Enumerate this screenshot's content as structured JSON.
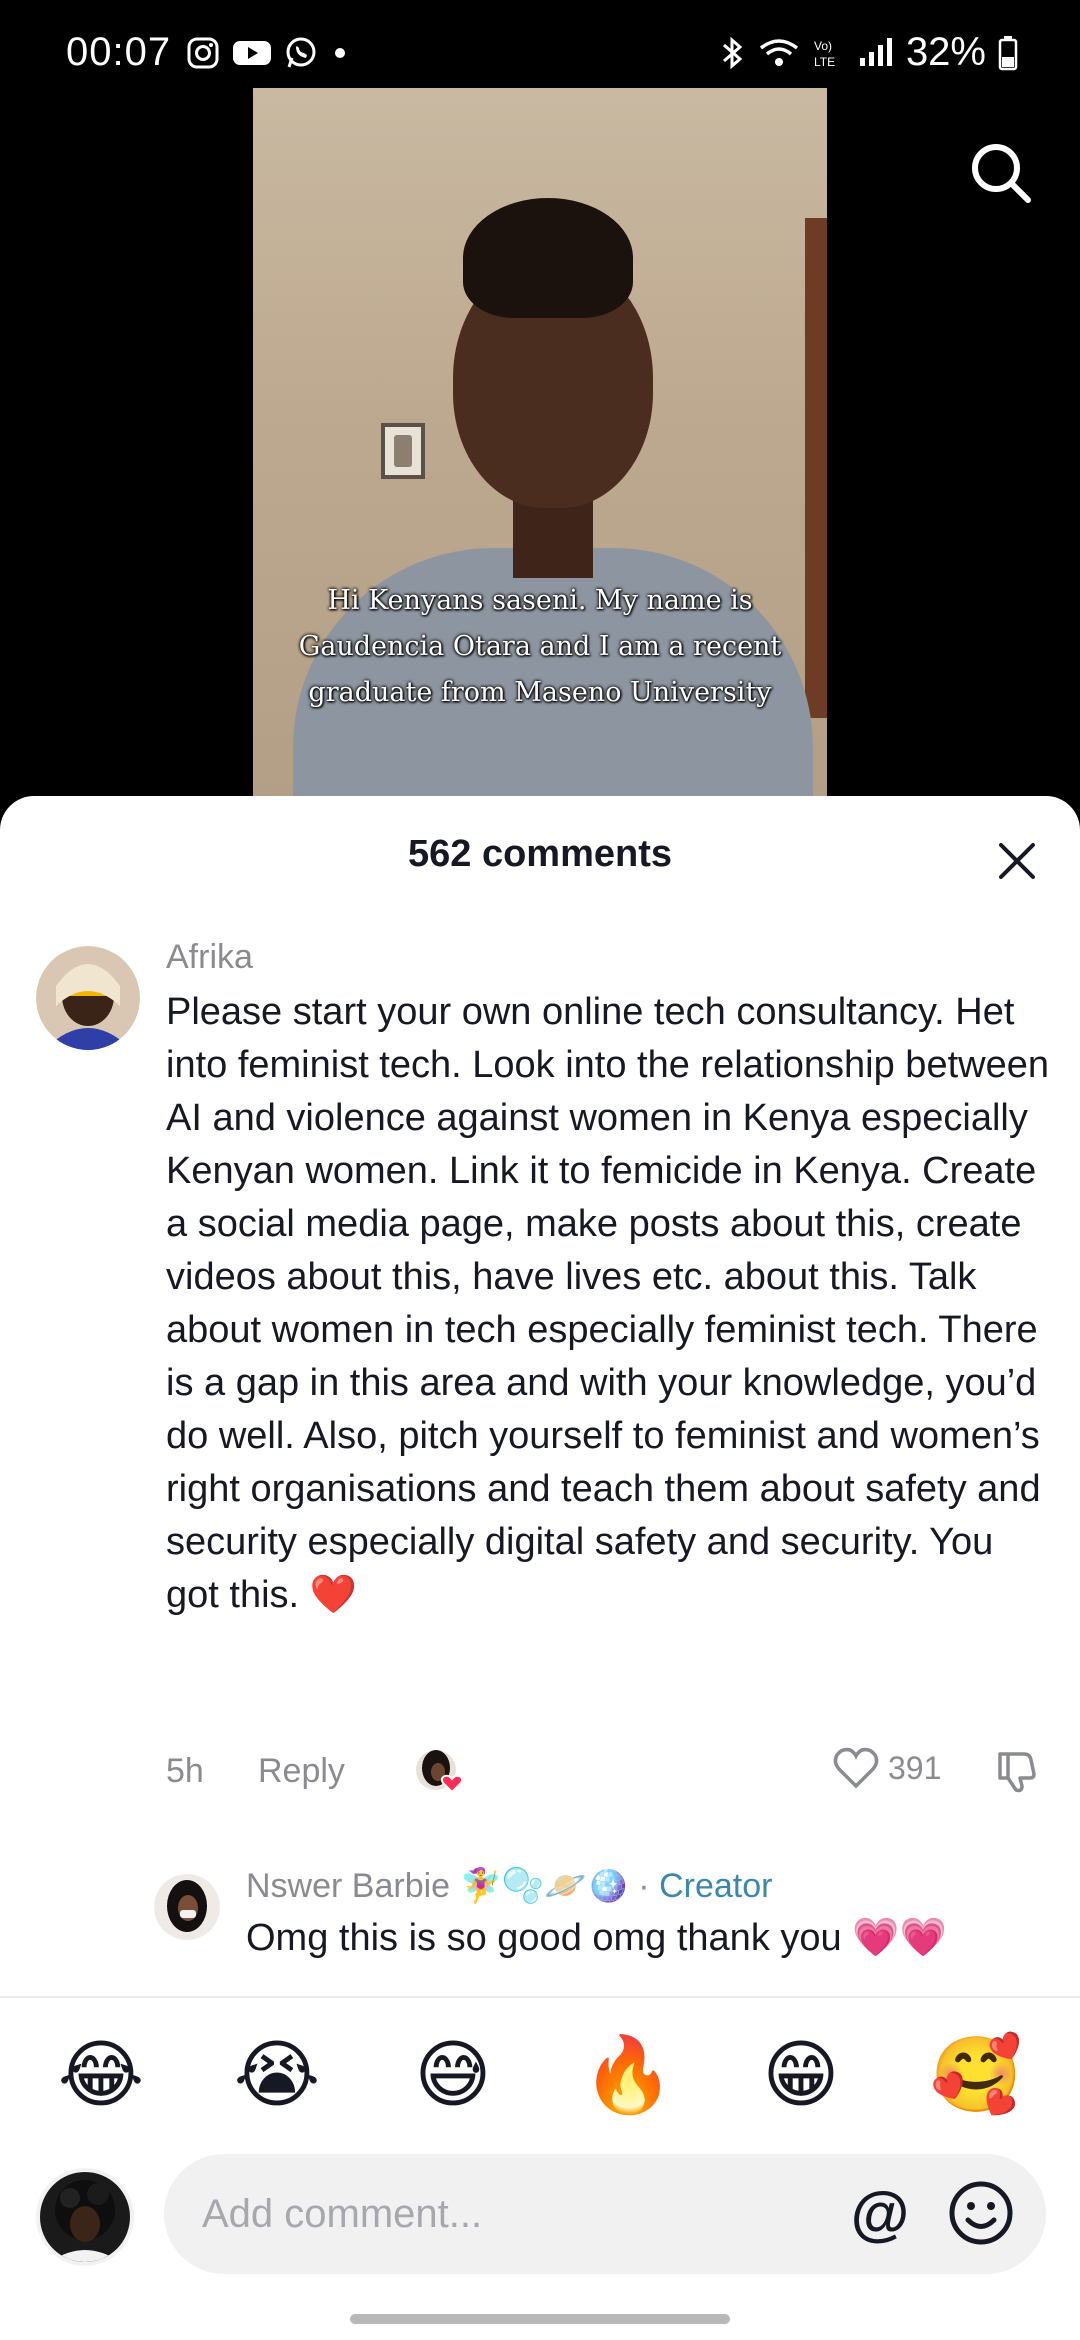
{
  "status_bar": {
    "time": "00:07",
    "battery": "32%",
    "network": "Vo) LTE"
  },
  "video": {
    "caption_lines": [
      "Hi Kenyans saseni. My name is",
      "Gaudencia Otara and I am a recent",
      "graduate from Maseno University"
    ]
  },
  "comments_sheet": {
    "title": "562 comments",
    "comments": [
      {
        "username": "Afrika",
        "text": "Please start your own online tech consultancy. Het into feminist tech. Look into the relationship between AI and violence against women in Kenya especially Kenyan women. Link it to femicide in Kenya. Create a social media page, make posts about this, create videos about this, have lives etc. about this. Talk about women in tech especially feminist tech. There is a gap in this area and with your knowledge, you’d do well. Also, pitch yourself to feminist and women’s right organisations and teach them about safety and security especially digital safety and security. You got this. ❤️",
        "time": "5h",
        "reply_label": "Reply",
        "likes": "391"
      },
      {
        "username": "Nswer Barbie 🧚‍♀️🫧🪐🪩",
        "separator": " · ",
        "badge": "Creator",
        "text": "Omg this is so good omg thank you 💗💗"
      }
    ],
    "quick_emojis": [
      "😂",
      "😭",
      "😅",
      "🔥",
      "😁",
      "🥰"
    ],
    "input": {
      "placeholder": "Add comment...",
      "mention_symbol": "@"
    }
  },
  "colors": {
    "accent_creator": "#3c87ad",
    "like_heart": "#fe2c55"
  }
}
